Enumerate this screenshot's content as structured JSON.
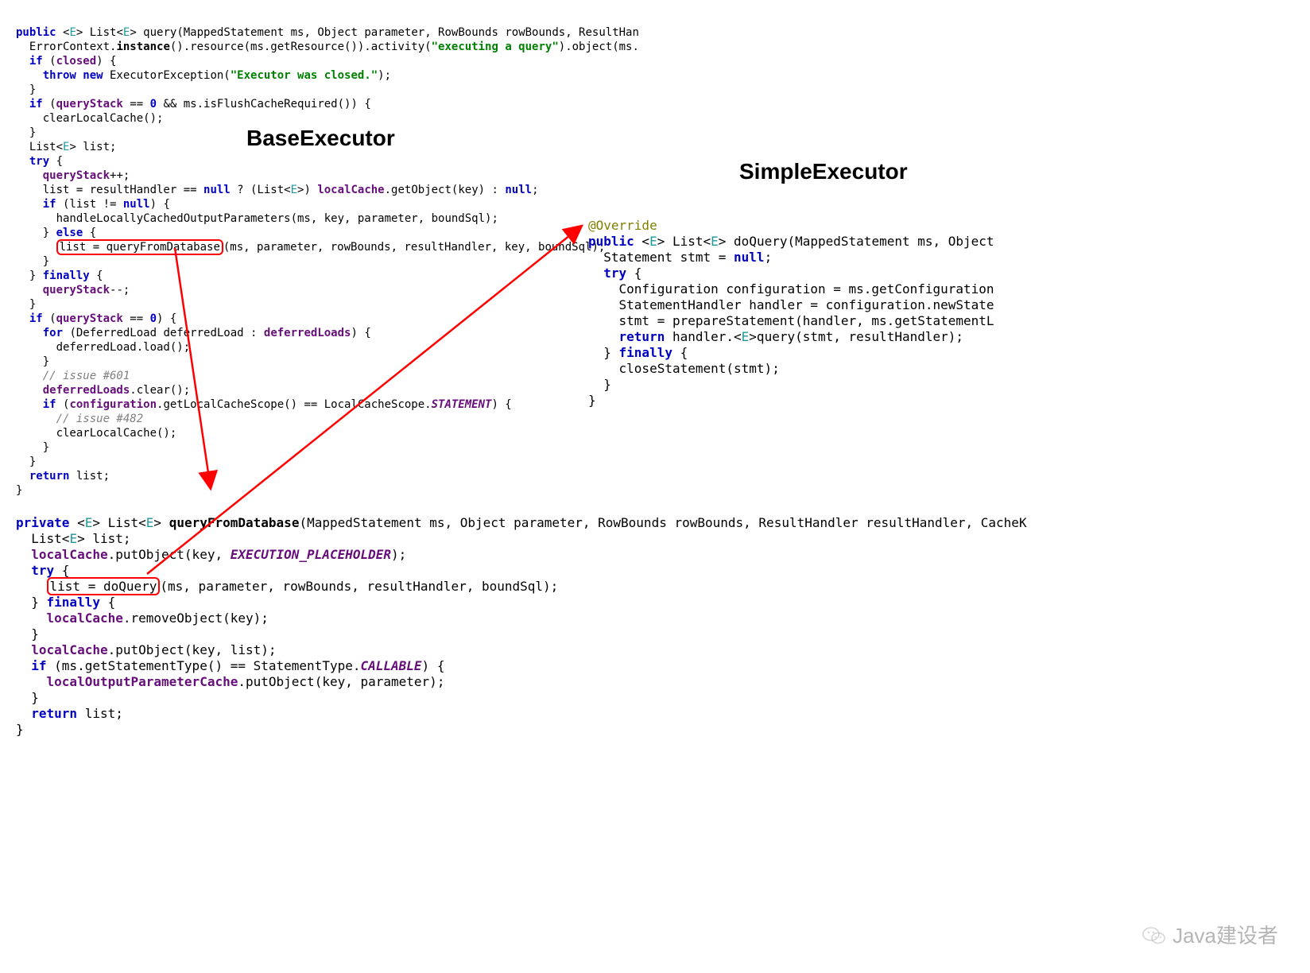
{
  "titles": {
    "base": "BaseExecutor",
    "simple": "SimpleExecutor"
  },
  "base": {
    "l01a": "public",
    "l01b": " <",
    "l01c": "E",
    "l01d": "> List<",
    "l01e": "E",
    "l01f": "> query(MappedStatement ms, Object parameter, RowBounds rowBounds, ResultHan",
    "l02a": "  ErrorContext.",
    "l02b": "instance",
    "l02c": "().resource(ms.getResource()).activity(",
    "l02d": "\"executing a query\"",
    "l02e": ").object(ms.",
    "l03a": "  if",
    "l03b": " (",
    "l03c": "closed",
    "l03d": ") {",
    "l04a": "    throw new",
    "l04b": " ExecutorException(",
    "l04c": "\"Executor was closed.\"",
    "l04d": ");",
    "l05": "  }",
    "l06a": "  if",
    "l06b": " (",
    "l06c": "queryStack",
    "l06d": " == ",
    "l06e": "0",
    "l06f": " && ms.isFlushCacheRequired()) {",
    "l07": "    clearLocalCache();",
    "l08": "  }",
    "l09a": "  List<",
    "l09b": "E",
    "l09c": "> list;",
    "l10a": "  try",
    "l10b": " {",
    "l11a": "    queryStack",
    "l11b": "++;",
    "l12a": "    list = resultHandler == ",
    "l12b": "null",
    "l12c": " ? (List<",
    "l12d": "E",
    "l12e": ">) ",
    "l12f": "localCache",
    "l12g": ".getObject(key) : ",
    "l12h": "null",
    "l12i": ";",
    "l13a": "    if",
    "l13b": " (list != ",
    "l13c": "null",
    "l13d": ") {",
    "l14": "      handleLocallyCachedOutputParameters(ms, key, parameter, boundSql);",
    "l15a": "    } ",
    "l15b": "else",
    "l15c": " {",
    "l16a": "      ",
    "l16hl": "list = queryFromDatabase",
    "l16b": "(ms, parameter, rowBounds, resultHandler, key, boundSql);",
    "l17": "    }",
    "l18a": "  } ",
    "l18b": "finally",
    "l18c": " {",
    "l19a": "    queryStack",
    "l19b": "--;",
    "l20": "  }",
    "l21a": "  if",
    "l21b": " (",
    "l21c": "queryStack",
    "l21d": " == ",
    "l21e": "0",
    "l21f": ") {",
    "l22a": "    for",
    "l22b": " (DeferredLoad deferredLoad : ",
    "l22c": "deferredLoads",
    "l22d": ") {",
    "l23": "      deferredLoad.load();",
    "l24": "    }",
    "l25a": "    ",
    "l25b": "// issue #601",
    "l26a": "    deferredLoads",
    "l26b": ".clear();",
    "l27a": "    if",
    "l27b": " (",
    "l27c": "configuration",
    "l27d": ".getLocalCacheScope() == LocalCacheScope.",
    "l27e": "STATEMENT",
    "l27f": ") {",
    "l28a": "      ",
    "l28b": "// issue #482",
    "l29": "      clearLocalCache();",
    "l30": "    }",
    "l31": "  }",
    "l32a": "  return",
    "l32b": " list;",
    "l33": "}"
  },
  "qfd": {
    "l01a": "private",
    "l01b": " <",
    "l01c": "E",
    "l01d": "> List<",
    "l01e": "E",
    "l01f": "> ",
    "l01g": "queryFromDatabase",
    "l01h": "(MappedStatement ms, Object parameter, RowBounds rowBounds, ResultHandler resultHandler, CacheK",
    "l02a": "  List<",
    "l02b": "E",
    "l02c": "> list;",
    "l03a": "  localCache",
    "l03b": ".putObject(key, ",
    "l03c": "EXECUTION_PLACEHOLDER",
    "l03d": ");",
    "l04a": "  try",
    "l04b": " {",
    "l05a": "    ",
    "l05hl": "list = doQuery",
    "l05b": "(ms, parameter, rowBounds, resultHandler, boundSql);",
    "l06a": "  } ",
    "l06b": "finally",
    "l06c": " {",
    "l07a": "    localCache",
    "l07b": ".removeObject(key);",
    "l08": "  }",
    "l09a": "  localCache",
    "l09b": ".putObject(key, list);",
    "l10a": "  if",
    "l10b": " (ms.getStatementType() == StatementType.",
    "l10c": "CALLABLE",
    "l10d": ") {",
    "l11a": "    localOutputParameterCache",
    "l11b": ".putObject(key, parameter);",
    "l12": "  }",
    "l13a": "  return",
    "l13b": " list;",
    "l14": "}"
  },
  "simple": {
    "l01": "@Override",
    "l02a": "public",
    "l02b": " <",
    "l02c": "E",
    "l02d": "> List<",
    "l02e": "E",
    "l02f": "> doQuery(MappedStatement ms, Object",
    "l03a": "  Statement stmt = ",
    "l03b": "null",
    "l03c": ";",
    "l04a": "  try",
    "l04b": " {",
    "l05": "    Configuration configuration = ms.getConfiguration",
    "l06": "    StatementHandler handler = configuration.newState",
    "l07": "    stmt = prepareStatement(handler, ms.getStatementL",
    "l08a": "    return",
    "l08b": " handler.<",
    "l08c": "E",
    "l08d": ">query(stmt, resultHandler);",
    "l09a": "  } ",
    "l09b": "finally",
    "l09c": " {",
    "l10": "    closeStatement(stmt);",
    "l11": "  }",
    "l12": "}"
  },
  "watermark": "Java建设者"
}
